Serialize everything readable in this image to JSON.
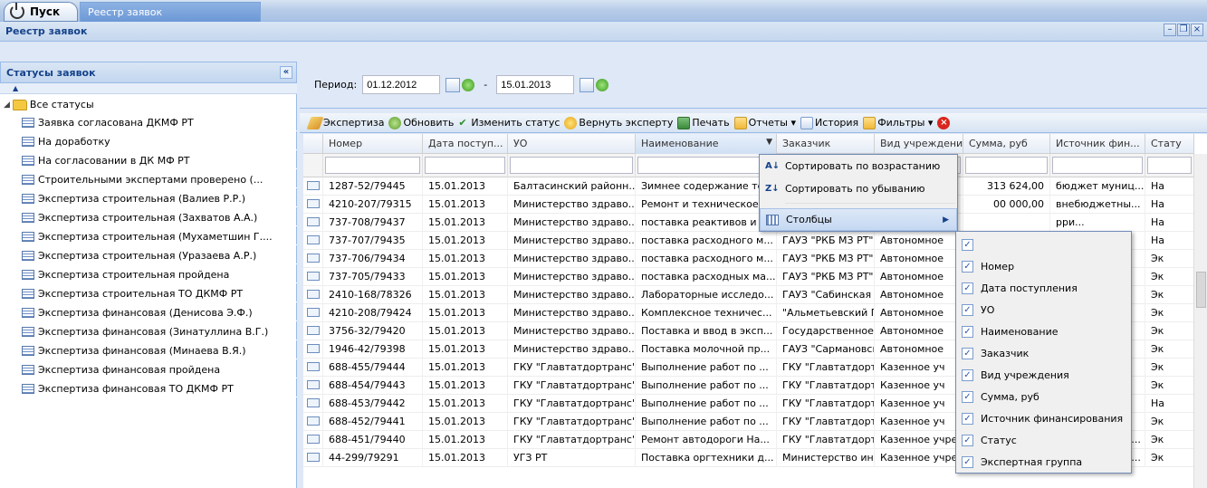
{
  "taskbar": {
    "start_label": "Пуск",
    "active_task": "Реестр заявок"
  },
  "window": {
    "title": "Реестр заявок"
  },
  "left_panel": {
    "title": "Статусы заявок",
    "root": "Все статусы",
    "items": [
      "Заявка согласована ДКМФ РТ",
      "На доработку",
      "На согласовании в ДК МФ РТ",
      "Строительными экспертами проверено (...",
      "Экспертиза строительная (Валиев Р.Р.)",
      "Экспертиза строительная (Захватов А.А.)",
      "Экспертиза строительная (Мухаметшин Г....",
      "Экспертиза строительная (Уразаева А.Р.)",
      "Экспертиза строительная пройдена",
      "Экспертиза строительная ТО ДКМФ РТ",
      "Экспертиза финансовая (Денисова Э.Ф.)",
      "Экспертиза финансовая (Зинатуллина В.Г.)",
      "Экспертиза финансовая (Минаева В.Я.)",
      "Экспертиза финансовая пройдена",
      "Экспертиза финансовая ТО ДКМФ РТ"
    ]
  },
  "period": {
    "label": "Период:",
    "from": "01.12.2012",
    "dash": "-",
    "to": "15.01.2013"
  },
  "toolbar": {
    "expertise": "Экспертиза",
    "refresh": "Обновить",
    "change_status": "Изменить статус",
    "return_expert": "Вернуть эксперту",
    "print": "Печать",
    "reports": "Отчеты ▾",
    "history": "История",
    "filters": "Фильтры ▾"
  },
  "grid": {
    "columns": [
      "Номер",
      "Дата поступ...",
      "УО",
      "Наименование",
      "Заказчик",
      "Вид учреждения",
      "Сумма, руб",
      "Источник фин...",
      "Стату"
    ],
    "rows": [
      [
        "1287-52/79445",
        "15.01.2013",
        "Балтасинский районн...",
        "Зимнее содержание те...",
        "",
        "...учр...",
        "313 624,00",
        "бюджет муниц...",
        "На"
      ],
      [
        "4210-207/79315",
        "15.01.2013",
        "Министерство здраво...",
        "Ремонт и техническое ...",
        "",
        "",
        "00 000,00",
        "внебюджетны...",
        "На"
      ],
      [
        "737-708/79437",
        "15.01.2013",
        "Министерство здраво...",
        "поставка реактивов и р...",
        "",
        "",
        "",
        "рри...",
        "На"
      ],
      [
        "737-707/79435",
        "15.01.2013",
        "Министерство здраво...",
        "поставка расходного м...",
        "ГАУЗ \"РКБ МЗ РТ\"",
        "Автономное",
        "",
        "рри...",
        "На"
      ],
      [
        "737-706/79434",
        "15.01.2013",
        "Министерство здраво...",
        "поставка расходного м...",
        "ГАУЗ \"РКБ МЗ РТ\"",
        "Автономное",
        "",
        "рри...",
        "Эк"
      ],
      [
        "737-705/79433",
        "15.01.2013",
        "Министерство здраво...",
        "поставка расходных ма...",
        "ГАУЗ \"РКБ МЗ РТ\"",
        "Автономное",
        "",
        "рри...",
        "Эк"
      ],
      [
        "2410-168/78326",
        "15.01.2013",
        "Министерство здраво...",
        "Лабораторные исследо...",
        "ГАУЗ \"Сабинская Ц...",
        "Автономное",
        "",
        "рри...",
        "Эк"
      ],
      [
        "4210-208/79424",
        "15.01.2013",
        "Министерство здраво...",
        "Комплексное техничес...",
        "\"Альметьевский ПН...",
        "Автономное",
        "",
        "рри...",
        "Эк"
      ],
      [
        "3756-32/79420",
        "15.01.2013",
        "Министерство здраво...",
        "Поставка и ввод в эксп...",
        "Государственное а...",
        "Автономное",
        "",
        "тны...",
        "Эк"
      ],
      [
        "1946-42/79398",
        "15.01.2013",
        "Министерство здраво...",
        "Поставка молочной пр...",
        "ГАУЗ \"Сармановска...",
        "Автономное",
        "",
        "рри...",
        "Эк"
      ],
      [
        "688-455/79444",
        "15.01.2013",
        "ГКУ \"Главтатдортранс\"",
        "Выполнение работ по ...",
        "ГКУ \"Главтатдортра...",
        "Казенное уч",
        "",
        "спу...",
        "Эк"
      ],
      [
        "688-454/79443",
        "15.01.2013",
        "ГКУ \"Главтатдортранс\"",
        "Выполнение работ по ...",
        "ГКУ \"Главтатдортра...",
        "Казенное уч",
        "",
        "спу...",
        "Эк"
      ],
      [
        "688-453/79442",
        "15.01.2013",
        "ГКУ \"Главтатдортранс\"",
        "Выполнение работ по ...",
        "ГКУ \"Главтатдортра...",
        "Казенное уч",
        "",
        "спу...",
        "На"
      ],
      [
        "688-452/79441",
        "15.01.2013",
        "ГКУ \"Главтатдортранс\"",
        "Выполнение работ по ...",
        "ГКУ \"Главтатдортра...",
        "Казенное уч",
        "",
        "спу...",
        "Эк"
      ],
      [
        "688-451/79440",
        "15.01.2013",
        "ГКУ \"Главтатдортранс\"",
        "Ремонт автодороги На...",
        "ГКУ \"Главтатдортра...",
        "Казенное учре...",
        "33 282 011,00",
        "бюджет Респу...",
        "Эк"
      ],
      [
        "44-299/79291",
        "15.01.2013",
        "УГЗ РТ",
        "Поставка оргтехники д...",
        "Министерство инф...",
        "Казенное учре...",
        "173 910,00",
        "бюджет Респу...",
        "Эк"
      ]
    ]
  },
  "context_menu": {
    "sort_asc": "Сортировать по возрастанию",
    "sort_desc": "Сортировать по убыванию",
    "columns": "Столбцы"
  },
  "columns_menu": {
    "items": [
      "",
      "Номер",
      "Дата поступления",
      "УО",
      "Наименование",
      "Заказчик",
      "Вид учреждения",
      "Сумма, руб",
      "Источник финансирования",
      "Статус",
      "Экспертная группа"
    ]
  }
}
